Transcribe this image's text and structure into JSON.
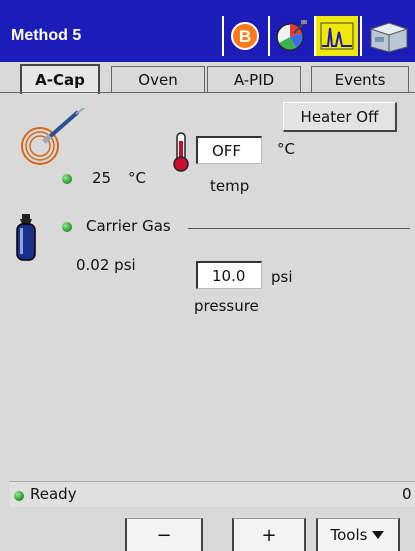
{
  "title_bar": {
    "title": "Method 5",
    "buttons": [
      {
        "icon": "b-circle-icon"
      },
      {
        "icon": "settings-pie-icon"
      },
      {
        "icon": "chromatogram-icon"
      },
      {
        "icon": "instrument-icon"
      }
    ]
  },
  "tabs": [
    {
      "label": "A-Cap",
      "active": true
    },
    {
      "label": "Oven",
      "active": false
    },
    {
      "label": "A-PID",
      "active": false
    },
    {
      "label": "Events",
      "active": false
    }
  ],
  "acap": {
    "heater_button": "Heater Off",
    "temp_value": "OFF",
    "temp_unit": "°C",
    "temp_label": "temp",
    "current_temp": "25",
    "current_temp_unit": "°C",
    "carrier_gas_label": "Carrier Gas",
    "current_pressure": "0.02 psi",
    "pressure_value": "10.0",
    "pressure_unit": "psi",
    "pressure_label": "pressure"
  },
  "status": {
    "text": "Ready",
    "count": "0"
  },
  "bottom": {
    "minus": "−",
    "plus": "+",
    "tools": "Tools"
  },
  "colors": {
    "titlebar": "#1c1cb8",
    "background": "#d9d9d9",
    "indicator_green": "#1f8f1f"
  }
}
